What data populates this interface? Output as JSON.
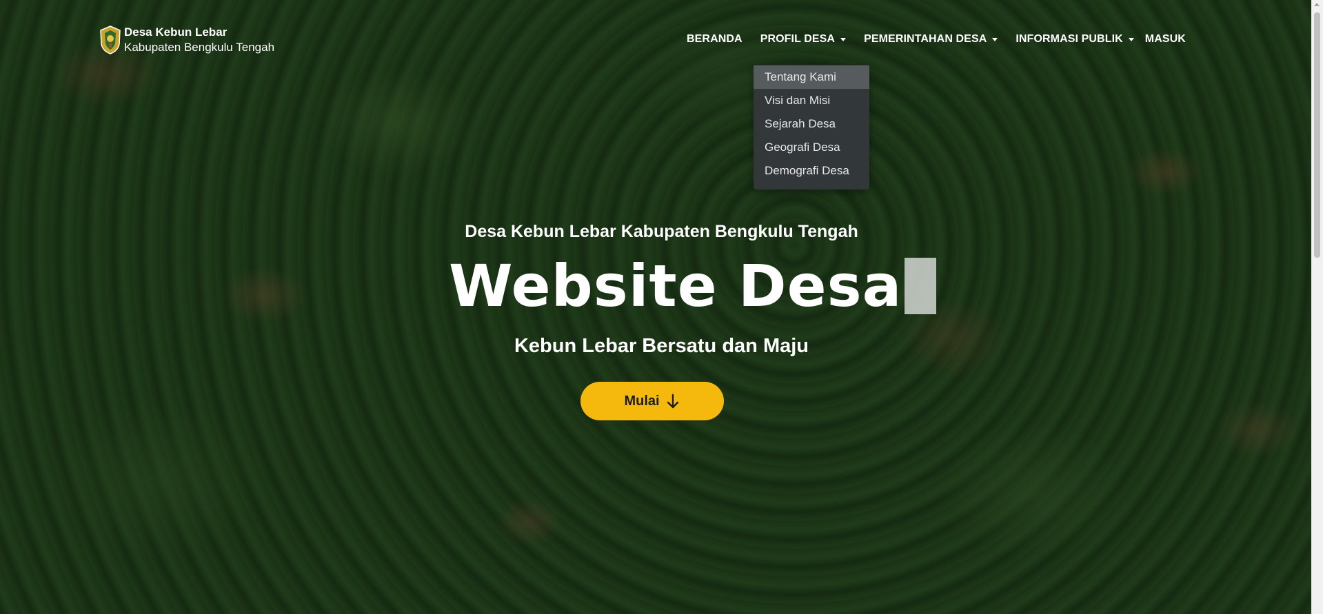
{
  "brand": {
    "name": "Desa Kebun Lebar",
    "subtitle": "Kabupaten Bengkulu Tengah",
    "logo_icon": "regency-emblem-icon"
  },
  "nav": {
    "items": [
      {
        "label": "BERANDA",
        "has_dropdown": false
      },
      {
        "label": "PROFIL DESA",
        "has_dropdown": true
      },
      {
        "label": "PEMERINTAHAN DESA",
        "has_dropdown": true
      },
      {
        "label": "INFORMASI PUBLIK",
        "has_dropdown": true
      },
      {
        "label": "MASUK",
        "has_dropdown": false
      }
    ]
  },
  "dropdown": {
    "parent": "PROFIL DESA",
    "items": [
      {
        "label": "Tentang Kami",
        "active": true
      },
      {
        "label": "Visi dan Misi",
        "active": false
      },
      {
        "label": "Sejarah Desa",
        "active": false
      },
      {
        "label": "Geografi Desa",
        "active": false
      },
      {
        "label": "Demografi Desa",
        "active": false
      }
    ]
  },
  "hero": {
    "top_title": "Desa Kebun Lebar Kabupaten Bengkulu Tengah",
    "headline": "Website Desa",
    "tagline": "Kebun Lebar Bersatu dan Maju",
    "cta_label": "Mulai",
    "cta_icon": "arrow-down-icon"
  },
  "colors": {
    "accent": "#f5b90d",
    "dropdown_bg": "#34383c",
    "text": "#ffffff"
  }
}
